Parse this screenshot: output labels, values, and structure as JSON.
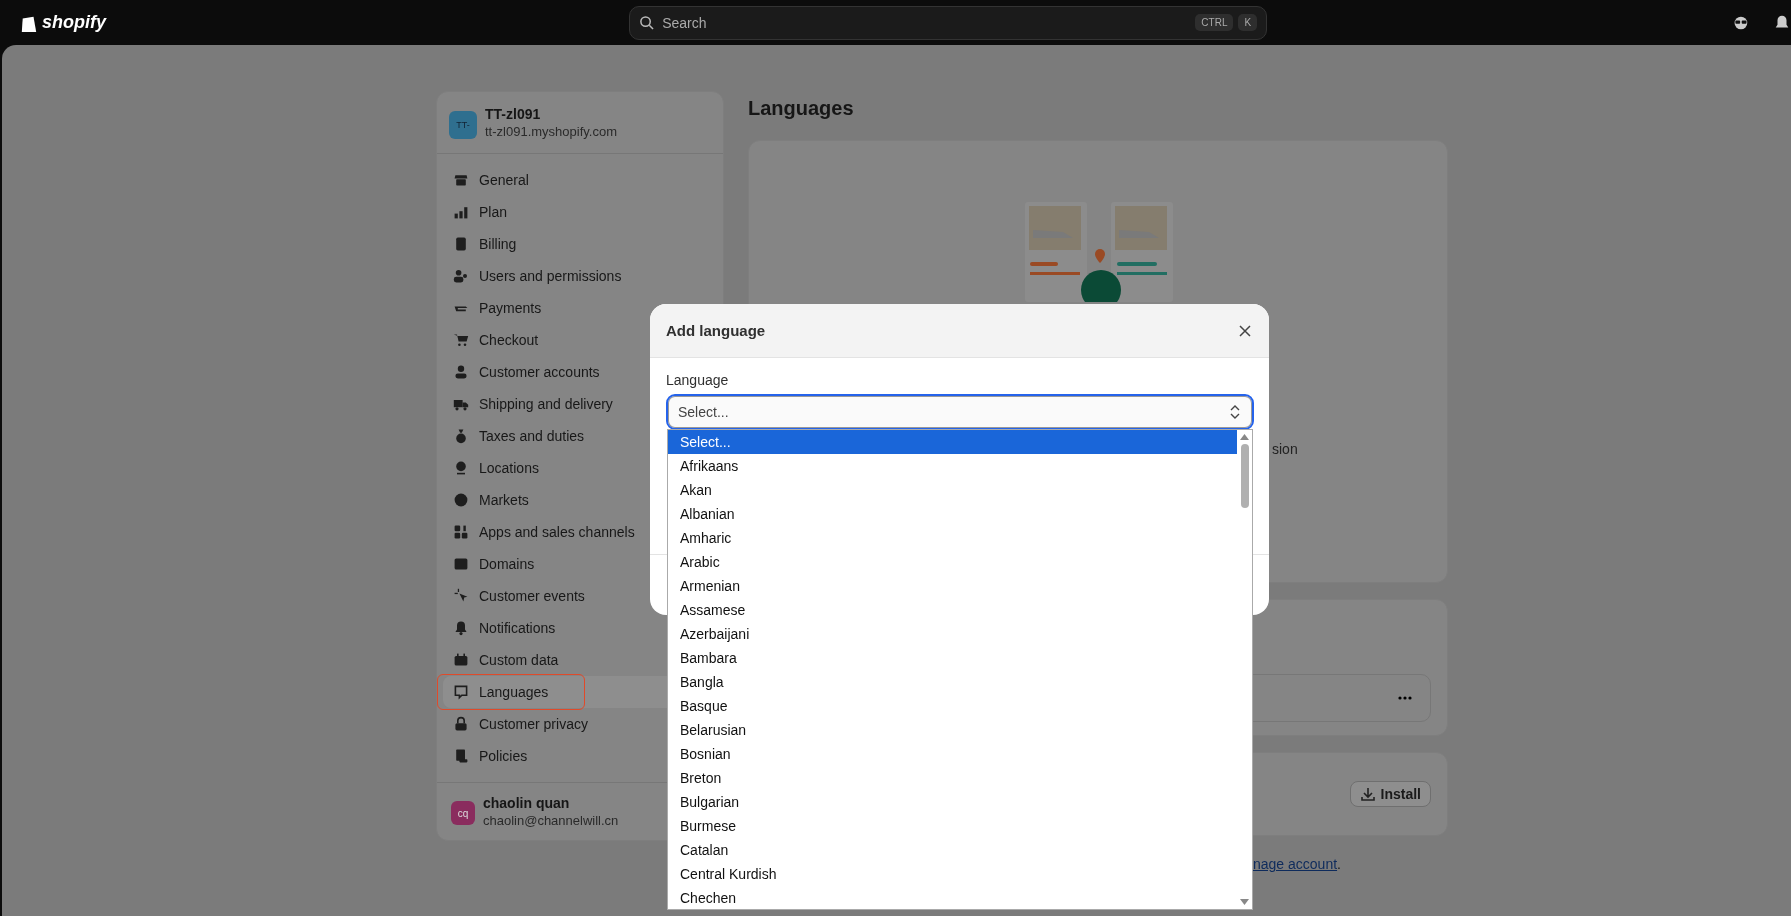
{
  "topbar": {
    "logo": "shopify",
    "search": {
      "placeholder": "Search",
      "keys": [
        "CTRL",
        "K"
      ]
    }
  },
  "sidebar": {
    "store": {
      "initials": "TT-",
      "name": "TT-zl091",
      "domain": "tt-zl091.myshopify.com"
    },
    "items": [
      {
        "label": "General",
        "selected": false,
        "highlighted": false
      },
      {
        "label": "Plan",
        "selected": false,
        "highlighted": false
      },
      {
        "label": "Billing",
        "selected": false,
        "highlighted": false
      },
      {
        "label": "Users and permissions",
        "selected": false,
        "highlighted": false
      },
      {
        "label": "Payments",
        "selected": false,
        "highlighted": false
      },
      {
        "label": "Checkout",
        "selected": false,
        "highlighted": false
      },
      {
        "label": "Customer accounts",
        "selected": false,
        "highlighted": false
      },
      {
        "label": "Shipping and delivery",
        "selected": false,
        "highlighted": false
      },
      {
        "label": "Taxes and duties",
        "selected": false,
        "highlighted": false
      },
      {
        "label": "Locations",
        "selected": false,
        "highlighted": false
      },
      {
        "label": "Markets",
        "selected": false,
        "highlighted": false
      },
      {
        "label": "Apps and sales channels",
        "selected": false,
        "highlighted": false
      },
      {
        "label": "Domains",
        "selected": false,
        "highlighted": false
      },
      {
        "label": "Customer events",
        "selected": false,
        "highlighted": false
      },
      {
        "label": "Notifications",
        "selected": false,
        "highlighted": false
      },
      {
        "label": "Custom data",
        "selected": false,
        "highlighted": false
      },
      {
        "label": "Languages",
        "selected": true,
        "highlighted": true
      },
      {
        "label": "Customer privacy",
        "selected": false,
        "highlighted": false
      },
      {
        "label": "Policies",
        "selected": false,
        "highlighted": false
      }
    ],
    "user": {
      "initials": "cq",
      "name": "chaolin quan",
      "email": "chaolin@channelwill.cn"
    }
  },
  "page": {
    "title": "Languages",
    "card_text": "sion",
    "install_button": "Install",
    "footer_link": "nage account",
    "footer_tail": "."
  },
  "modal": {
    "title": "Add language",
    "field_label": "Language",
    "value": "Select...",
    "options": [
      {
        "label": "Select...",
        "selected": true
      },
      {
        "label": "Afrikaans",
        "selected": false
      },
      {
        "label": "Akan",
        "selected": false
      },
      {
        "label": "Albanian",
        "selected": false
      },
      {
        "label": "Amharic",
        "selected": false
      },
      {
        "label": "Arabic",
        "selected": false
      },
      {
        "label": "Armenian",
        "selected": false
      },
      {
        "label": "Assamese",
        "selected": false
      },
      {
        "label": "Azerbaijani",
        "selected": false
      },
      {
        "label": "Bambara",
        "selected": false
      },
      {
        "label": "Bangla",
        "selected": false
      },
      {
        "label": "Basque",
        "selected": false
      },
      {
        "label": "Belarusian",
        "selected": false
      },
      {
        "label": "Bosnian",
        "selected": false
      },
      {
        "label": "Breton",
        "selected": false
      },
      {
        "label": "Bulgarian",
        "selected": false
      },
      {
        "label": "Burmese",
        "selected": false
      },
      {
        "label": "Catalan",
        "selected": false
      },
      {
        "label": "Central Kurdish",
        "selected": false
      },
      {
        "label": "Chechen",
        "selected": false
      }
    ]
  }
}
